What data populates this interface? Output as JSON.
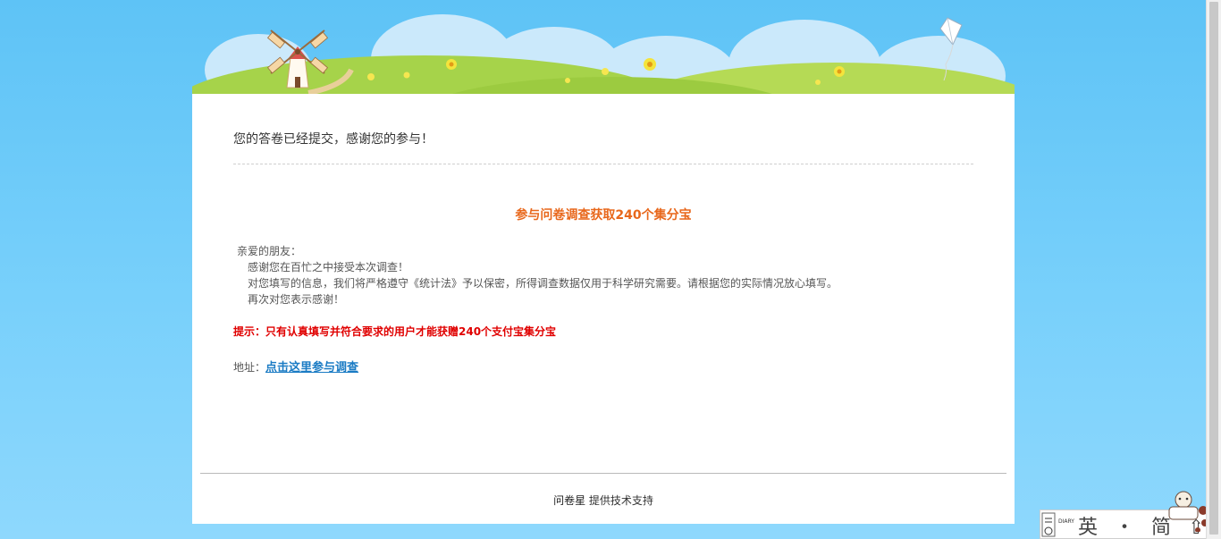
{
  "confirmation": {
    "message": "您的答卷已经提交，感谢您的参与！"
  },
  "promo": {
    "title": "参与问卷调查获取240个集分宝",
    "greeting": "亲爱的朋友：",
    "lines": [
      "感谢您在百忙之中接受本次调查！",
      "对您填写的信息，我们将严格遵守《统计法》予以保密，所得调查数据仅用于科学研究需要。请根据您的实际情况放心填写。",
      "再次对您表示感谢！"
    ],
    "tip": "提示：只有认真填写并符合要求的用户才能获赠240个支付宝集分宝",
    "address_label": "地址：",
    "address_link": "点击这里参与调查"
  },
  "footer": {
    "brand": "问卷星",
    "text": "提供技术支持"
  },
  "widget": {
    "chars": "英 ・ 简 ⇧",
    "diary_label": "DIARY"
  },
  "colors": {
    "sky": "#5ec3f6",
    "promo_title": "#e8671b",
    "tip": "#e00000",
    "link": "#1a7bc4"
  },
  "icons": [
    "windmill-icon",
    "kite-icon",
    "flower-icon",
    "mascot-icon"
  ]
}
